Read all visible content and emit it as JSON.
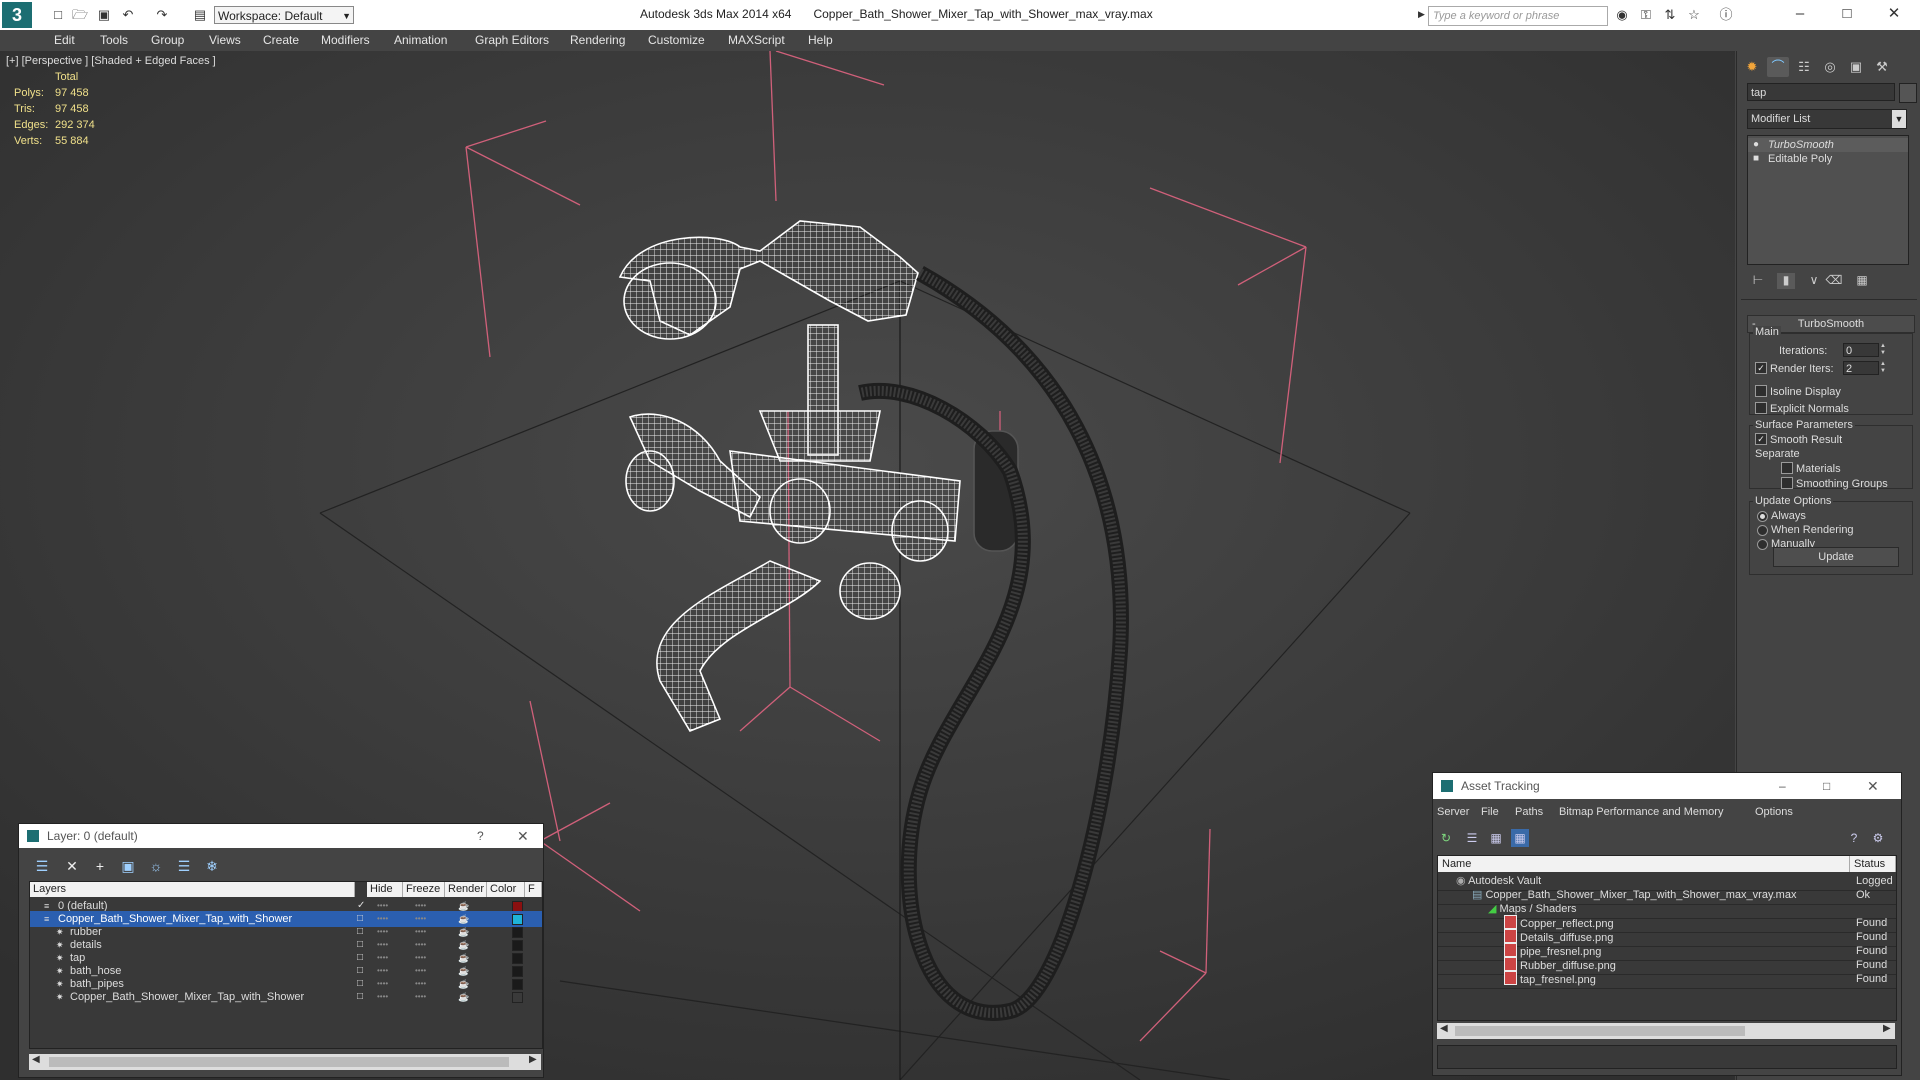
{
  "titlebar": {
    "app_title": "Autodesk 3ds Max  2014 x64",
    "file_title": "Copper_Bath_Shower_Mixer_Tap_with_Shower_max_vray.max",
    "workspace": "Workspace: Default",
    "search_placeholder": "Type a keyword or phrase"
  },
  "menu": [
    "Edit",
    "Tools",
    "Group",
    "Views",
    "Create",
    "Modifiers",
    "Animation",
    "Graph Editors",
    "Rendering",
    "Customize",
    "MAXScript",
    "Help"
  ],
  "viewport": {
    "label": "[+] [Perspective ] [Shaded + Edged Faces ]",
    "stats": {
      "header": "Total",
      "rows": [
        {
          "label": "Polys:",
          "value": "97 458"
        },
        {
          "label": "Tris:",
          "value": "97 458"
        },
        {
          "label": "Edges:",
          "value": "292 374"
        },
        {
          "label": "Verts:",
          "value": "55 884"
        }
      ]
    }
  },
  "command_panel": {
    "object_name": "tap",
    "modifier_list": "Modifier List",
    "stack": [
      "TurboSmooth",
      "Editable Poly"
    ],
    "rollout_title": "TurboSmooth",
    "main_group": "Main",
    "iterations_label": "Iterations:",
    "iterations_value": "0",
    "render_iters_label": "Render Iters:",
    "render_iters_value": "2",
    "isoline_label": "Isoline Display",
    "explicit_normals_label": "Explicit Normals",
    "surface_group": "Surface Parameters",
    "smooth_result_label": "Smooth Result",
    "separate_label": "Separate",
    "materials_label": "Materials",
    "smoothing_groups_label": "Smoothing Groups",
    "update_group": "Update Options",
    "always_label": "Always",
    "when_rendering_label": "When Rendering",
    "manually_label": "Manually",
    "update_button": "Update"
  },
  "layer_window": {
    "title": "Layer: 0 (default)",
    "help": "?",
    "columns": [
      "Layers",
      "Hide",
      "Freeze",
      "Render",
      "Color",
      "F"
    ],
    "rows": [
      {
        "name": "0 (default)",
        "color": "#8a1010",
        "indent": 1,
        "selected": false,
        "checked": true
      },
      {
        "name": "Copper_Bath_Shower_Mixer_Tap_with_Shower",
        "color": "#1fb3d8",
        "indent": 1,
        "selected": true,
        "checked": false
      },
      {
        "name": "rubber",
        "color": "#1a1a1a",
        "indent": 2,
        "selected": false,
        "checked": false
      },
      {
        "name": "details",
        "color": "#1a1a1a",
        "indent": 2,
        "selected": false,
        "checked": false
      },
      {
        "name": "tap",
        "color": "#1a1a1a",
        "indent": 2,
        "selected": false,
        "checked": false
      },
      {
        "name": "bath_hose",
        "color": "#1a1a1a",
        "indent": 2,
        "selected": false,
        "checked": false
      },
      {
        "name": "bath_pipes",
        "color": "#1a1a1a",
        "indent": 2,
        "selected": false,
        "checked": false
      },
      {
        "name": "Copper_Bath_Shower_Mixer_Tap_with_Shower",
        "color": "#3a3a3a",
        "indent": 2,
        "selected": false,
        "checked": false
      }
    ]
  },
  "asset_window": {
    "title": "Asset Tracking",
    "menu": [
      "Server",
      "File",
      "Paths",
      "Bitmap Performance and Memory",
      "Options"
    ],
    "columns": [
      "Name",
      "Status"
    ],
    "rows": [
      {
        "name": "Autodesk Vault",
        "status": "Logged",
        "level": 0
      },
      {
        "name": "Copper_Bath_Shower_Mixer_Tap_with_Shower_max_vray.max",
        "status": "Ok",
        "level": 1
      },
      {
        "name": "Maps / Shaders",
        "status": "",
        "level": 2
      },
      {
        "name": "Copper_reflect.png",
        "status": "Found",
        "level": 3
      },
      {
        "name": "Details_diffuse.png",
        "status": "Found",
        "level": 3
      },
      {
        "name": "pipe_fresnel.png",
        "status": "Found",
        "level": 3
      },
      {
        "name": "Rubber_diffuse.png",
        "status": "Found",
        "level": 3
      },
      {
        "name": "tap_fresnel.png",
        "status": "Found",
        "level": 3
      }
    ]
  }
}
